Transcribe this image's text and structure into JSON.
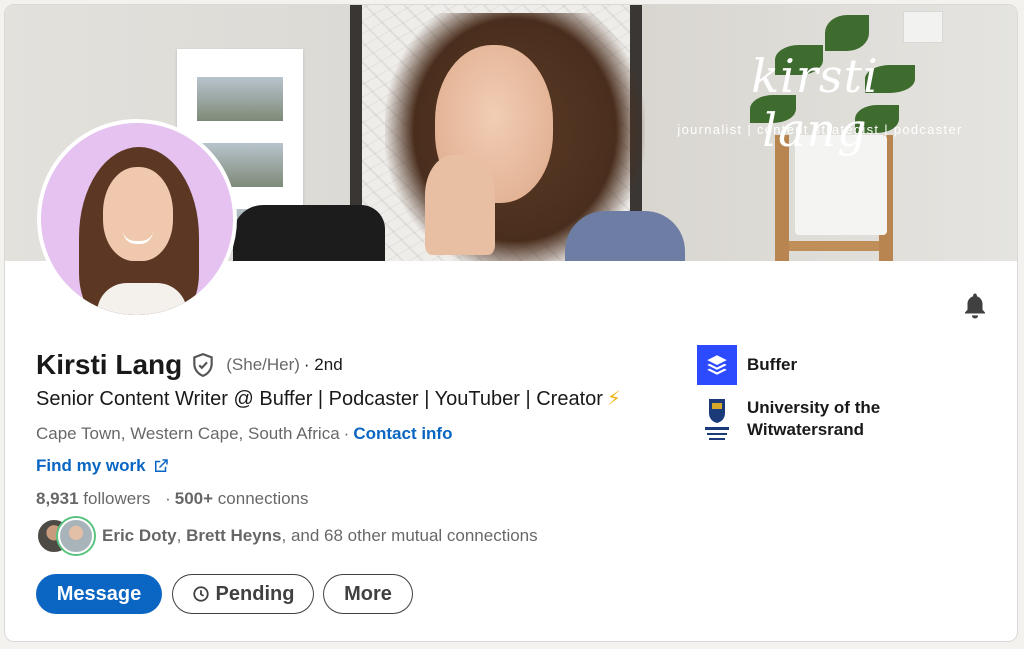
{
  "banner": {
    "brand_name": "kirsti lang",
    "brand_tagline": "journalist | content strategist | podcaster"
  },
  "profile": {
    "name": "Kirsti Lang",
    "pronouns": "(She/Her)",
    "degree": "· 2nd",
    "headline": "Senior Content Writer @ Buffer | Podcaster | YouTuber | Creator",
    "headline_emoji": "⚡",
    "location": "Cape Town, Western Cape, South Africa",
    "location_separator": "·",
    "contact_info_label": "Contact info",
    "find_work_label": "Find my work",
    "followers_count": "8,931",
    "followers_label": " followers",
    "connections_separator": "·",
    "connections_count": "500+",
    "connections_label": " connections",
    "mutual_name_1": "Eric Doty",
    "mutual_sep": ", ",
    "mutual_name_2": "Brett Heyns",
    "mutual_rest": ", and 68 other mutual connections"
  },
  "actions": {
    "message_label": "Message",
    "pending_label": "Pending",
    "more_label": "More"
  },
  "experience": [
    {
      "name": "Buffer",
      "logo_icon": "buffer-logo-icon"
    },
    {
      "name": "University of the Witwatersrand",
      "logo_icon": "wits-logo-icon"
    }
  ],
  "colors": {
    "accent": "#0a66c2",
    "avatar_bg": "#e5c2f0",
    "buffer_logo": "#2c4bff",
    "bolt": "#f2b61d"
  }
}
